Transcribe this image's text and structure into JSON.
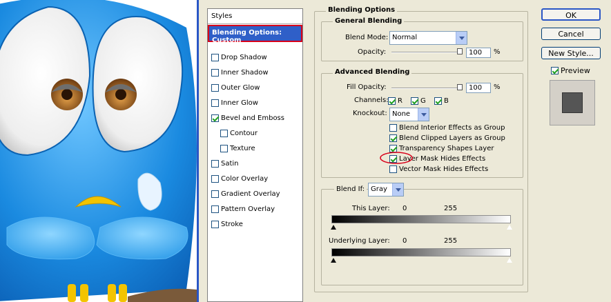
{
  "styles_panel": {
    "header": "Styles",
    "selected": "Blending Options: Custom",
    "items": [
      {
        "label": "Drop Shadow",
        "checked": false
      },
      {
        "label": "Inner Shadow",
        "checked": false
      },
      {
        "label": "Outer Glow",
        "checked": false
      },
      {
        "label": "Inner Glow",
        "checked": false
      },
      {
        "label": "Bevel and Emboss",
        "checked": true
      },
      {
        "label": "Contour",
        "checked": false
      },
      {
        "label": "Texture",
        "checked": false
      },
      {
        "label": "Satin",
        "checked": false
      },
      {
        "label": "Color Overlay",
        "checked": false
      },
      {
        "label": "Gradient Overlay",
        "checked": false
      },
      {
        "label": "Pattern Overlay",
        "checked": false
      },
      {
        "label": "Stroke",
        "checked": false
      }
    ]
  },
  "blending": {
    "title": "Blending Options",
    "general": {
      "title": "General Blending",
      "blend_mode_label": "Blend Mode:",
      "blend_mode_value": "Normal",
      "opacity_label": "Opacity:",
      "opacity_value": "100",
      "opacity_unit": "%"
    },
    "advanced": {
      "title": "Advanced Blending",
      "fill_opacity_label": "Fill Opacity:",
      "fill_opacity_value": "100",
      "fill_opacity_unit": "%",
      "channels_label": "Channels:",
      "channel_r": "R",
      "channel_g": "G",
      "channel_b": "B",
      "knockout_label": "Knockout:",
      "knockout_value": "None",
      "options": [
        {
          "label": "Blend Interior Effects as Group",
          "checked": false
        },
        {
          "label": "Blend Clipped Layers as Group",
          "checked": true
        },
        {
          "label": "Transparency Shapes Layer",
          "checked": true
        },
        {
          "label": "Layer Mask Hides Effects",
          "checked": true
        },
        {
          "label": "Vector Mask Hides Effects",
          "checked": false
        }
      ]
    },
    "blend_if": {
      "label": "Blend If:",
      "value": "Gray",
      "this_layer_label": "This Layer:",
      "this_layer_min": "0",
      "this_layer_max": "255",
      "underlying_label": "Underlying Layer:",
      "underlying_min": "0",
      "underlying_max": "255"
    }
  },
  "buttons": {
    "ok": "OK",
    "cancel": "Cancel",
    "new_style": "New Style...",
    "preview": "Preview"
  },
  "colors": {
    "selection": "#2f5fc8",
    "highlight_border": "#d8001a",
    "dialog_bg": "#ece9d8",
    "bird_blue": "#1e8fe0"
  }
}
